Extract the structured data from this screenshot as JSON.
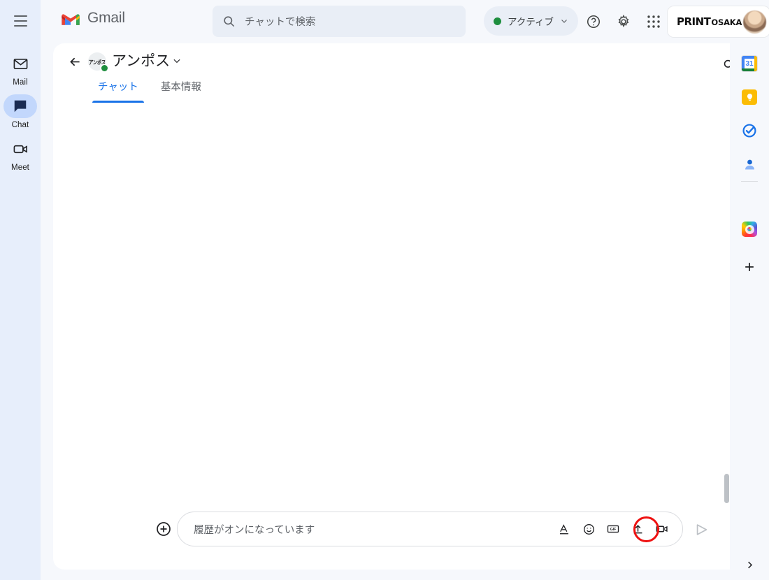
{
  "app": {
    "product_name": "Gmail",
    "brand_line1": "PRINT",
    "brand_line2": "OSAKA"
  },
  "search": {
    "placeholder": "チャットで検索",
    "icon": "search-icon"
  },
  "status": {
    "label": "アクティブ",
    "dot_color": "#1e8e3e",
    "caret": "chevron-down-icon"
  },
  "topbar_icons": [
    {
      "name": "help-icon",
      "label": "ヘルプ"
    },
    {
      "name": "settings-gear-icon",
      "label": "設定"
    },
    {
      "name": "apps-grid-icon",
      "label": "Google アプリ"
    }
  ],
  "left_rail": {
    "menu_icon": "hamburger-menu-icon",
    "items": [
      {
        "id": "mail",
        "label": "Mail",
        "icon": "envelope-icon",
        "active": false
      },
      {
        "id": "chat",
        "label": "Chat",
        "icon": "chat-bubble-icon",
        "active": true
      },
      {
        "id": "meet",
        "label": "Meet",
        "icon": "video-camera-icon",
        "active": false
      }
    ]
  },
  "conversation": {
    "back_icon": "back-arrow-icon",
    "avatar_text": "アンポス",
    "title": "アンポス",
    "caret": "chevron-down-icon",
    "presence_color": "#1e8e3e",
    "header_icons": [
      {
        "name": "search-in-conversation-icon"
      },
      {
        "name": "open-in-new-window-icon"
      }
    ],
    "tabs": [
      {
        "id": "chat",
        "label": "チャット",
        "active": true
      },
      {
        "id": "info",
        "label": "基本情報",
        "active": false
      }
    ]
  },
  "composer": {
    "add_icon": "plus-circle-icon",
    "placeholder": "履歴がオンになっています",
    "icons": [
      {
        "name": "text-format-icon",
        "glyph": "A"
      },
      {
        "name": "emoji-icon"
      },
      {
        "name": "gif-icon",
        "glyph": "GIF"
      },
      {
        "name": "upload-file-icon",
        "highlighted": true
      },
      {
        "name": "video-meeting-icon"
      }
    ],
    "send_icon": "send-icon",
    "annotation_color": "#ee1111"
  },
  "right_rail": {
    "items": [
      {
        "id": "calendar",
        "name": "google-calendar-icon",
        "day": "31"
      },
      {
        "id": "keep",
        "name": "google-keep-icon"
      },
      {
        "id": "tasks",
        "name": "google-tasks-icon"
      },
      {
        "id": "contacts",
        "name": "google-contacts-icon"
      },
      {
        "id": "creative-cloud",
        "name": "adobe-creative-cloud-icon"
      }
    ],
    "add_label": "アドオンを取得",
    "add_icon": "plus-icon",
    "expand_icon": "chevron-right-icon"
  },
  "colors": {
    "rail_bg": "#e7eefb",
    "page_bg": "#f6f8fc",
    "card_bg": "#ffffff",
    "accent_blue": "#1a73e8",
    "active_pill": "#c2d7fc"
  }
}
